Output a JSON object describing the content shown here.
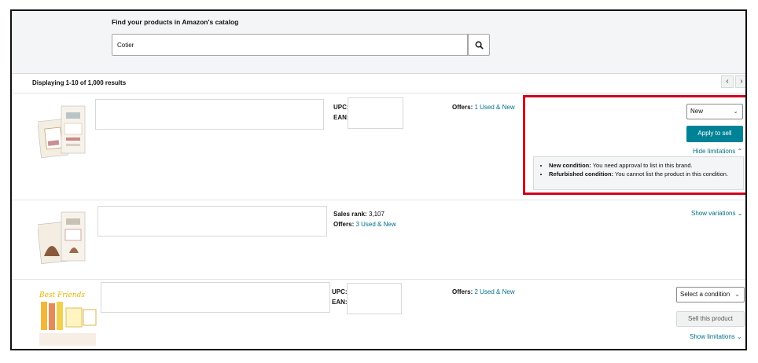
{
  "header": {
    "title": "Find your products in Amazon's catalog",
    "search_value": "Cotier",
    "search_icon": "search-icon"
  },
  "results": {
    "count_text": "Displaying 1-10 of 1,000 results",
    "prev_icon": "chevron-left-icon",
    "next_icon": "chevron-right-icon"
  },
  "labels": {
    "upc": "UPC:",
    "ean": "EAN:",
    "offers": "Offers:",
    "sales_rank": "Sales rank:"
  },
  "items": [
    {
      "offers_link": "1 Used & New",
      "condition": "New",
      "action": "Apply to sell",
      "limit_toggle": "Hide limitations",
      "limitations": [
        {
          "label": "New condition:",
          "text": "You need approval to list in this brand."
        },
        {
          "label": "Refurbished condition:",
          "text": "You cannot list the product in this condition."
        }
      ]
    },
    {
      "sales_rank": "3,107",
      "offers_link": "3 Used & New",
      "variations_toggle": "Show variations"
    },
    {
      "offers_link": "2 Used & New",
      "condition": "Select a condition",
      "action": "Sell this product",
      "limit_toggle": "Show limitations"
    }
  ],
  "colors": {
    "accent": "#008296",
    "link": "#007185",
    "highlight": "#d0021b"
  }
}
